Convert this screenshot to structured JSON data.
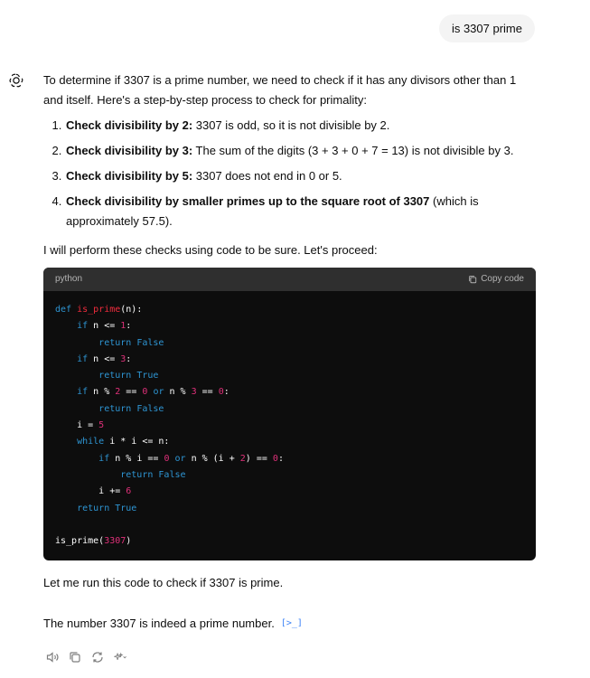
{
  "user_message": "is 3307 prime",
  "assistant": {
    "intro": "To determine if 3307 is a prime number, we need to check if it has any divisors other than 1 and itself. Here's a step-by-step process to check for primality:",
    "steps": [
      {
        "bold": "Check divisibility by 2:",
        "text": " 3307 is odd, so it is not divisible by 2."
      },
      {
        "bold": "Check divisibility by 3:",
        "text": " The sum of the digits (3 + 3 + 0 + 7 = 13) is not divisible by 3."
      },
      {
        "bold": "Check divisibility by 5:",
        "text": " 3307 does not end in 0 or 5."
      },
      {
        "bold": "Check divisibility by smaller primes up to the square root of 3307",
        "text": " (which is approximately 57.5)."
      }
    ],
    "after_list": "I will perform these checks using code to be sure. Let's proceed:",
    "code_block": {
      "language": "python",
      "copy_label": "Copy code"
    },
    "run_text": "Let me run this code to check if 3307 is prime.",
    "result_text": "The number 3307 is indeed a prime number.",
    "citation": "[>_]"
  },
  "actions": [
    "read-aloud-icon",
    "copy-icon",
    "regenerate-icon",
    "model-switch-icon"
  ]
}
